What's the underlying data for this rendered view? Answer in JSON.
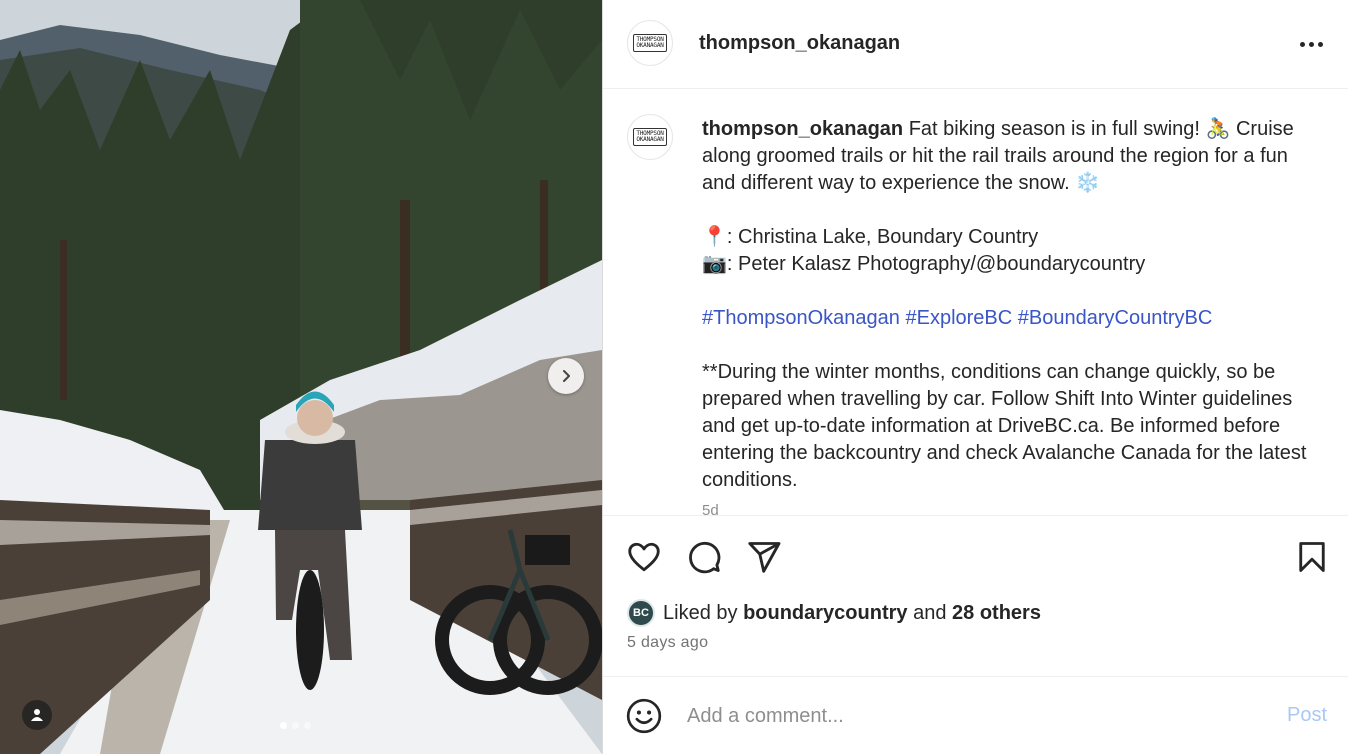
{
  "post": {
    "username": "thompson_okanagan",
    "avatar_logo_line1": "THOMPSON",
    "avatar_logo_line2": "OKANAGAN",
    "caption_user": "thompson_okanagan",
    "caption_lines": {
      "intro": "Fat biking season is in full swing! 🚴 Cruise along groomed trails or hit the rail trails around the region for a fun and different way to experience the snow. ❄️",
      "location": "📍: Christina Lake, Boundary Country",
      "photo_credit": "📷: Peter Kalasz Photography/@boundarycountry",
      "notice": "**During the winter months, conditions can change quickly, so be prepared when travelling by car. Follow Shift Into Winter guidelines and get up-to-date information at DriveBC.ca. Be informed before entering the backcountry and check Avalanche Canada for the latest conditions."
    },
    "hashtags": [
      "#ThompsonOkanagan",
      "#ExploreBC",
      "#BoundaryCountryBC"
    ],
    "caption_age": "5d",
    "likes": {
      "liker_avatar_text": "BC",
      "prefix": "Liked by",
      "liker": "boundarycountry",
      "and": "and",
      "others": "28 others"
    },
    "posted_ago": "5 days ago",
    "carousel": {
      "count": 3,
      "active_index": 0
    }
  },
  "comment": {
    "placeholder": "Add a comment...",
    "post_label": "Post"
  },
  "colors": {
    "hashtag": "#3a55c6",
    "post_button_disabled": "#a9c9f5",
    "muted_text": "#737373"
  },
  "icons": {
    "like": "heart-icon",
    "comment": "comment-icon",
    "share": "paper-plane-icon",
    "save": "bookmark-icon",
    "more": "more-horizontal-icon",
    "next": "chevron-right-icon",
    "tags": "user-tag-icon",
    "emoji": "smiley-icon"
  }
}
